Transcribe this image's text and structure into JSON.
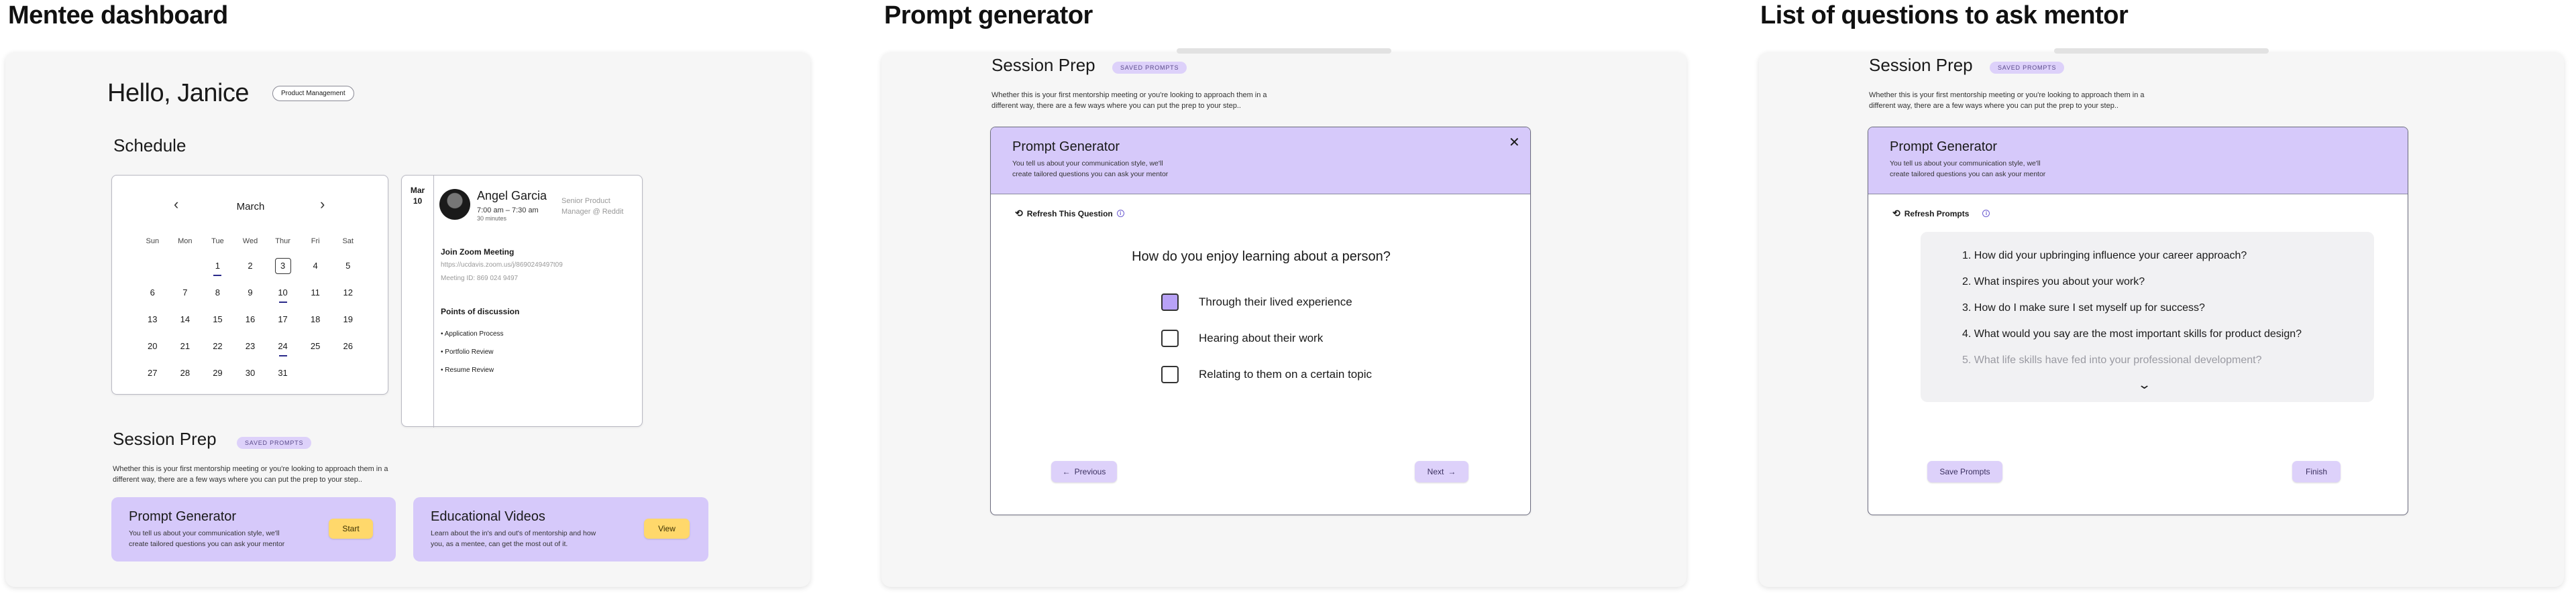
{
  "sections": {
    "mentee_dashboard": "Mentee dashboard",
    "prompt_generator": "Prompt generator",
    "questions_list": "List of questions to ask mentor"
  },
  "dashboard": {
    "greeting": "Hello, Janice",
    "tag": "Product Management",
    "schedule_title": "Schedule",
    "calendar": {
      "month": "March",
      "weekdays": [
        "Sun",
        "Mon",
        "Tue",
        "Wed",
        "Thur",
        "Fri",
        "Sat"
      ],
      "weeks": [
        [
          "",
          "",
          "1",
          "2",
          "3",
          "4",
          "5"
        ],
        [
          "6",
          "7",
          "8",
          "9",
          "10",
          "11",
          "12"
        ],
        [
          "13",
          "14",
          "15",
          "16",
          "17",
          "18",
          "19"
        ],
        [
          "20",
          "21",
          "22",
          "23",
          "24",
          "25",
          "26"
        ],
        [
          "27",
          "28",
          "29",
          "30",
          "31",
          "",
          ""
        ]
      ]
    },
    "event": {
      "month": "Mar",
      "day": "10",
      "name": "Angel Garcia",
      "time": "7:00 am – 7:30 am",
      "duration": "30 minutes",
      "role_line1": "Senior Product",
      "role_line2": "Manager @ Reddit",
      "zoom_title": "Join Zoom Meeting",
      "zoom_link": "https://ucdavis.zoom.us/j/8690249497t09",
      "meeting_id": "Meeting ID: 869 024 9497",
      "points_title": "Points of discussion",
      "points": [
        "Application Process",
        "Portfolio Review",
        "Resume Review"
      ]
    },
    "session_prep": {
      "title": "Session Prep",
      "tag": "SAVED PROMPTS",
      "desc_line1": "Whether this is your first mentorship meeting or you're looking to approach them in a",
      "desc_line2": "different way, there are a few ways where you can put the prep to your step..",
      "cards": [
        {
          "title": "Prompt Generator",
          "line1": "You tell us about your communication style, we'll",
          "line2": "create tailored questions you can ask your mentor",
          "button": "Start"
        },
        {
          "title": "Educational Videos",
          "line1": "Learn about the in's and out's of mentorship and how",
          "line2": "you, as a mentee, can get the most out of it.",
          "button": "View"
        }
      ]
    }
  },
  "generator": {
    "session_title": "Session Prep",
    "tag": "SAVED PROMPTS",
    "desc_line1": "Whether this is your first mentorship meeting or you're looking to approach them in a",
    "desc_line2": "different way, there are a few ways where you can put the prep to your step..",
    "modal_title": "Prompt Generator",
    "modal_line1": "You tell us about your communication style, we'll",
    "modal_line2": "create tailored questions you can ask your mentor",
    "refresh_label": "Refresh This Question",
    "question": "How do you enjoy learning about a person?",
    "options": [
      {
        "label": "Through their lived experience",
        "checked": true
      },
      {
        "label": "Hearing about their work",
        "checked": false
      },
      {
        "label": "Relating to them on a certain topic",
        "checked": false
      }
    ],
    "prev_label": "Previous",
    "next_label": "Next"
  },
  "questions": {
    "session_title": "Session Prep",
    "tag": "SAVED PROMPTS",
    "desc_line1": "Whether this is your first mentorship meeting or you're looking to approach them in a",
    "desc_line2": "different way, there are a few ways where you can put the prep to your step..",
    "modal_title": "Prompt Generator",
    "modal_line1": "You tell us about your communication style, we'll",
    "modal_line2": "create tailored questions you can ask your mentor",
    "refresh_label": "Refresh Prompts",
    "items": [
      "1. How did your upbringing influence your career approach?",
      "2. What inspires you about your work?",
      "3. How do I make sure I set myself up for success?",
      "4. What would you say are the most important skills for product design?",
      "5. What life skills have fed into your professional development?"
    ],
    "save_label": "Save Prompts",
    "finish_label": "Finish"
  },
  "colors": {
    "accent_lavender": "#d6c9fa",
    "accent_yellow": "#ffd86b",
    "panel_bg": "#f6f6f6"
  },
  "icons": {
    "prev": "chevron-left-icon",
    "next": "chevron-right-icon",
    "close": "close-icon",
    "refresh": "refresh-icon",
    "info": "info-icon",
    "expand": "chevron-down-icon",
    "avatar": "avatar"
  }
}
